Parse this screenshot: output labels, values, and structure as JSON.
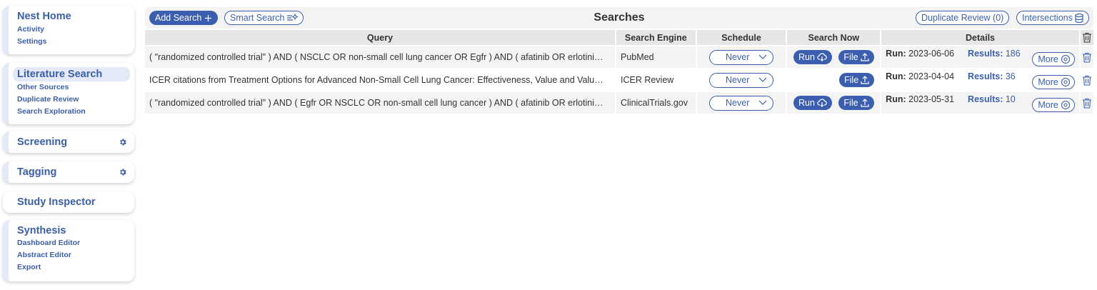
{
  "sidebar": {
    "nest_home": {
      "title": "Nest Home",
      "items": [
        "Activity",
        "Settings"
      ]
    },
    "literature_search": {
      "title": "Literature Search",
      "items": [
        "Other Sources",
        "Duplicate Review",
        "Search Exploration"
      ]
    },
    "screening": {
      "title": "Screening"
    },
    "tagging": {
      "title": "Tagging"
    },
    "study_inspector": {
      "title": "Study Inspector"
    },
    "synthesis": {
      "title": "Synthesis",
      "items": [
        "Dashboard Editor",
        "Abstract Editor",
        "Export"
      ]
    }
  },
  "toolbar": {
    "add_search": "Add Search",
    "smart_search": "Smart Search",
    "title": "Searches",
    "duplicate_review": "Duplicate Review (0)",
    "intersections": "Intersections"
  },
  "table": {
    "headers": [
      "Query",
      "Search Engine",
      "Schedule",
      "Search Now",
      "Details"
    ],
    "rows": [
      {
        "query": "( \"randomized controlled trial\" ) AND ( NSCLC OR non-small cell lung cancer OR Egfr ) AND ( afatinib OR erlotini…",
        "engine": "PubMed",
        "schedule": "Never",
        "run_button": "Run",
        "file_button": "File",
        "run_label": "Run:",
        "run_date": "2023-06-06",
        "results_label": "Results:",
        "results": "186",
        "more": "More"
      },
      {
        "query": "ICER citations from Treatment Options for Advanced Non-Small Cell Lung Cancer: Effectiveness, Value and Valu…",
        "engine": "ICER Review",
        "schedule": "Never",
        "run_button": "",
        "file_button": "File",
        "run_label": "Run:",
        "run_date": "2023-04-04",
        "results_label": "Results:",
        "results": "36",
        "more": "More"
      },
      {
        "query": "( \"randomized controlled trial\" ) AND ( Egfr OR NSCLC OR non-small cell lung cancer ) AND ( afatinib OR erlotini…",
        "engine": "ClinicalTrials.gov",
        "schedule": "Never",
        "run_button": "Run",
        "file_button": "File",
        "run_label": "Run:",
        "run_date": "2023-05-31",
        "results_label": "Results:",
        "results": "10",
        "more": "More"
      }
    ]
  },
  "colors": {
    "brand": "#3b5fae",
    "sidebar_accent": "#e3e9f6",
    "header_bg": "#e6e6e6"
  }
}
